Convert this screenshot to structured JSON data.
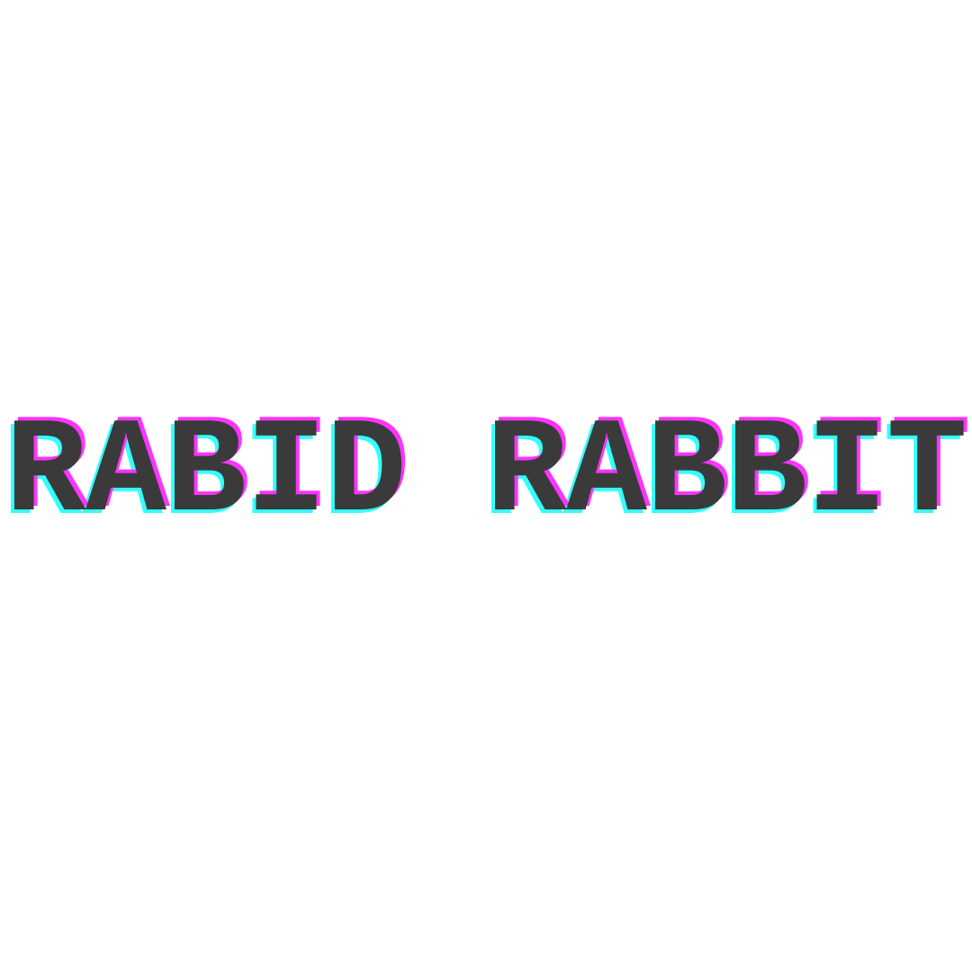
{
  "wordmark": {
    "text": "RABID RABBIT"
  },
  "colors": {
    "background": "#ffffff",
    "text": "#3a3a3a",
    "shadow_magenta": "#ff33ff",
    "shadow_cyan": "#33ffff"
  }
}
